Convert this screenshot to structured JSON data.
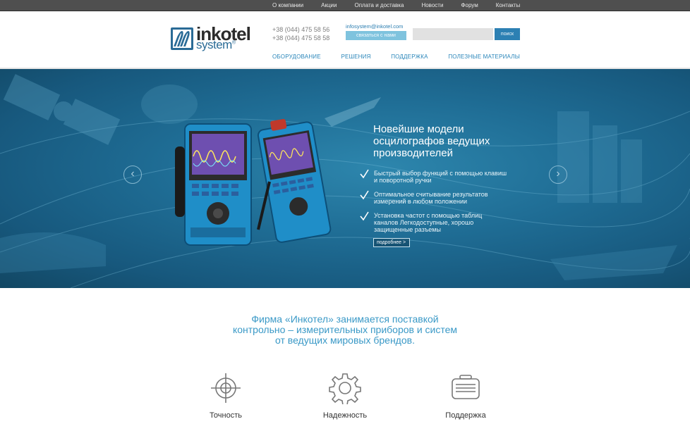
{
  "top_nav": [
    "О компании",
    "Акции",
    "Оплата и доставка",
    "Новости",
    "Форум",
    "Контакты"
  ],
  "header": {
    "logo_word1": "inkotel",
    "logo_word2": "system",
    "phone1": "+38 (044) 475 58 56",
    "phone2": "+38 (044) 475 58 58",
    "email": "infosystem@inkotel.com",
    "contact_button": "связаться с нами",
    "search_button": "поиск",
    "search_placeholder": ""
  },
  "main_nav": [
    "ОБОРУДОВАНИЕ",
    "РЕШЕНИЯ",
    "ПОДДЕРЖКА",
    "ПОЛЕЗНЫЕ МАТЕРИАЛЫ"
  ],
  "hero": {
    "title": "Новейшие модели осцилографов ведущих производителей",
    "features": [
      "Быстрый выбор функций с помощью клавиш и поворотной ручки",
      "Оптимальное считывание результатов измерений в любом положении",
      "Установка частот с помощью таблиц каналов Легкодоступные, хорошо защищенные разъемы"
    ],
    "more_button": "подробнее >",
    "prev_icon": "‹",
    "next_icon": "›"
  },
  "intro": {
    "line1": "Фирма «Инкотел» занимается поставкой",
    "line2": "контрольно – измерительных приборов и систем",
    "line3": "от ведущих мировых брендов."
  },
  "features": [
    {
      "label": "Точность",
      "icon": "crosshair-icon"
    },
    {
      "label": "Надежность",
      "icon": "gear-icon"
    },
    {
      "label": "Поддержка",
      "icon": "toolbox-icon"
    }
  ],
  "colors": {
    "topbar": "#4f4f4f",
    "accent": "#2c80b3",
    "hero": "#1f6d95",
    "intro_text": "#3a99c7"
  }
}
